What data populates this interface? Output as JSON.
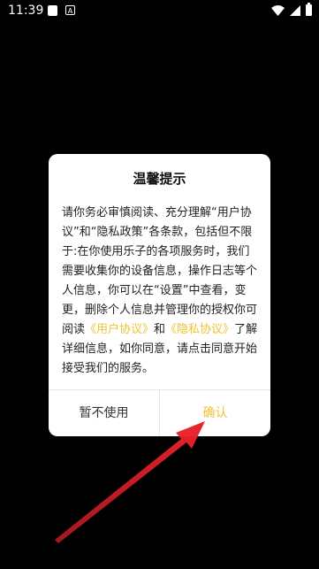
{
  "status_bar": {
    "time": "11:39",
    "icons": [
      "notification-square-icon",
      "a-badge-icon",
      "wifi-icon",
      "signal-icon",
      "battery-icon"
    ]
  },
  "dialog": {
    "title": "温馨提示",
    "body_part1": "请你务必审慎阅读、充分理解“用户协议”和“隐私政策”各条款，包括但不限于:在你使用乐子的各项服务时，我们需要收集你的设备信息，操作日志等个人信息，你可以在“设置”中查看，变更，删除个人信息并管理你的授权你可阅读",
    "link_user_agreement": "《用户协议》",
    "body_part2": "和",
    "link_privacy_policy": "《隐私协议》",
    "body_part3": "了解详细信息，如你同意，请点击同意开始接受我们的服务。",
    "decline_label": "暂不使用",
    "confirm_label": "确认"
  },
  "colors": {
    "background": "#000000",
    "dialog_bg": "#ffffff",
    "accent": "#f2c233",
    "annotation_arrow": "#e8212b"
  }
}
